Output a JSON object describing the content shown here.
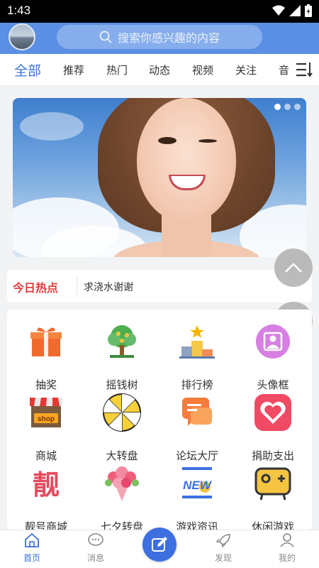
{
  "status_bar": {
    "time": "1:43"
  },
  "header": {
    "search_placeholder": "搜索你感兴趣的内容"
  },
  "tabs": [
    {
      "label": "全部",
      "active": true
    },
    {
      "label": "推荐"
    },
    {
      "label": "热门"
    },
    {
      "label": "动态"
    },
    {
      "label": "视频"
    },
    {
      "label": "关注"
    },
    {
      "label": "音"
    }
  ],
  "banner": {
    "slide_count": 3,
    "active_slide": 1
  },
  "hot": {
    "label": "今日热点",
    "text": "求浇水谢谢"
  },
  "grid": [
    {
      "label": "抽奖",
      "icon": "gift-icon"
    },
    {
      "label": "摇钱树",
      "icon": "money-tree-icon"
    },
    {
      "label": "排行榜",
      "icon": "podium-icon"
    },
    {
      "label": "头像框",
      "icon": "avatar-frame-icon"
    },
    {
      "label": "商城",
      "icon": "shop-icon"
    },
    {
      "label": "大转盘",
      "icon": "wheel-icon"
    },
    {
      "label": "论坛大厅",
      "icon": "forum-icon"
    },
    {
      "label": "捐助支出",
      "icon": "heart-icon"
    },
    {
      "label": "靓号商城",
      "icon": "liang-icon"
    },
    {
      "label": "七夕转盘",
      "icon": "flowers-icon"
    },
    {
      "label": "游戏资讯",
      "icon": "new-icon"
    },
    {
      "label": "休闲游戏",
      "icon": "gamepad-icon"
    }
  ],
  "grid_icon_text": {
    "shop": "shop",
    "liang": "靓",
    "new": "NEW"
  },
  "bottom_nav": [
    {
      "label": "首页",
      "active": true
    },
    {
      "label": "消息"
    },
    {
      "label": "发现"
    },
    {
      "label": "我的"
    }
  ],
  "colors": {
    "primary": "#5a8fe3",
    "active_blue": "#3b73d8",
    "hot_red": "#e43c3c"
  }
}
